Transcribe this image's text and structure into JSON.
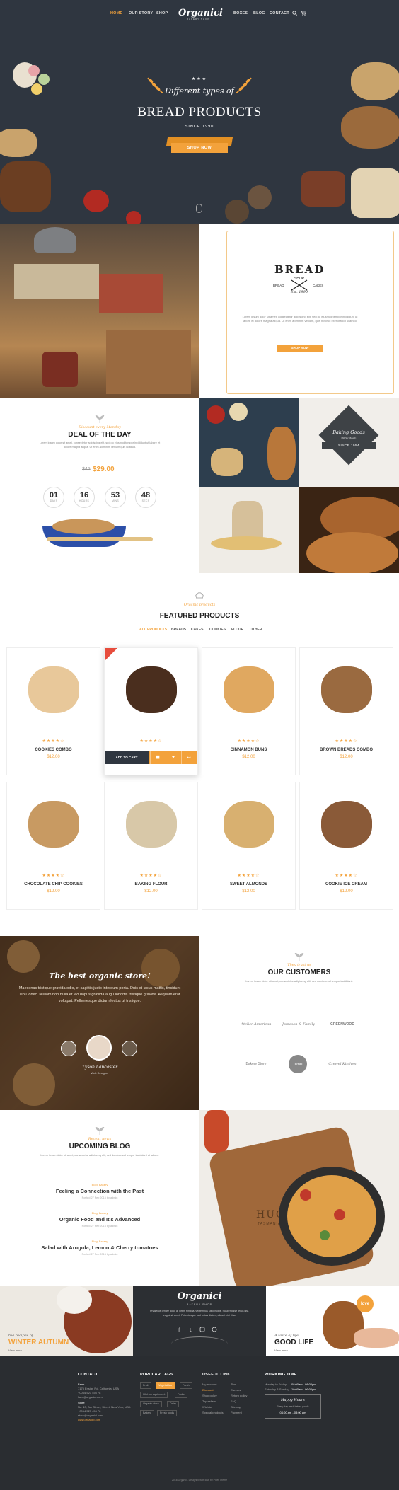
{
  "nav": {
    "left": [
      "HOME",
      "OUR STORY",
      "SHOP"
    ],
    "logo": "Organici",
    "logo_sub": "BAKERY SHOP",
    "right": [
      "BOXES",
      "BLOG",
      "CONTACT"
    ]
  },
  "hero": {
    "script": "Different types of",
    "title": "BREAD PRODUCTS",
    "since": "SINCE 1990",
    "button": "SHOP NOW"
  },
  "shop_panel": {
    "badge_title": "BREAD",
    "badge_shop": "SHOP",
    "badge_left": "BREAD",
    "badge_right": "CAKES",
    "badge_est": "Est. 1990",
    "text": "Lorem ipsum dolor sit amet, consectetur adipiscing elit, sed do eiusmod tempor incididunt ut labore et dolore magna aliqua. Ut enim ad minim veniam, quis nostrud exercitation ullamco.",
    "button": "SHOP NOW"
  },
  "deal": {
    "script": "Discount every Monday",
    "title": "DEAL OF THE DAY",
    "text": "Lorem ipsum dolor sit amet, consectetur adipiscing elit, sed do eiusmod tempor incididunt ut labore et dolore magna aliqua. Ut enim ad minim veniam quis nostrud.",
    "old_price": "$45",
    "price": "$29.00",
    "counters": [
      {
        "n": "01",
        "l": "DAYS"
      },
      {
        "n": "16",
        "l": "HOURS"
      },
      {
        "n": "53",
        "l": "MINS"
      },
      {
        "n": "48",
        "l": "SECS"
      }
    ]
  },
  "baking_badge": {
    "title": "Baking Goods",
    "sub": "HAND MADE",
    "since": "SINCE 1954"
  },
  "featured": {
    "script": "Organic products",
    "title": "FEATURED PRODUCTS",
    "filters": [
      "ALL PRODUCTS",
      "BREADS",
      "CAKES",
      "COOKIES",
      "FLOUR",
      "OTHER"
    ],
    "add_to_cart": "ADD TO CART",
    "products": [
      {
        "name": "COOKIES COMBO",
        "price": "$12.00",
        "stars": "★★★★☆",
        "color": "#e8c89a"
      },
      {
        "name": "",
        "price": "",
        "stars": "★★★★☆",
        "color": "#4a2e1e"
      },
      {
        "name": "CINNAMON BUNS",
        "price": "$12.00",
        "stars": "★★★★☆",
        "color": "#e0a860"
      },
      {
        "name": "BROWN BREADS COMBO",
        "price": "$12.00",
        "stars": "★★★★☆",
        "color": "#9a6a40"
      },
      {
        "name": "CHOCOLATE CHIP COOKIES",
        "price": "$12.00",
        "stars": "★★★★☆",
        "color": "#c89a62"
      },
      {
        "name": "BAKING FLOUR",
        "price": "$12.00",
        "stars": "★★★★☆",
        "color": "#d8c8a8"
      },
      {
        "name": "SWEET ALMONDS",
        "price": "$12.00",
        "stars": "★★★★☆",
        "color": "#d8b070"
      },
      {
        "name": "COOKIE ICE CREAM",
        "price": "$12.00",
        "stars": "★★★★☆",
        "color": "#8a5a38"
      }
    ]
  },
  "testimonial": {
    "title": "The best organic store!",
    "text": "Maecenas tristique gravida odio, et sagittis justo interdum porta. Duis et lacus mattis, tincidunt leo Donec. Nullam non nulla et leo dapus gravida augu lobortis tristique gravida. Aliquam erat volutpat. Pellentesque dictum lectus ut tristique.",
    "name": "Tyson Lancaster",
    "role": "Web Designer"
  },
  "customers": {
    "script": "They trust us",
    "title": "OUR CUSTOMERS",
    "text": "Lorem ipsum dolor sit amet, consectetur adipiscing elit, sed do eiusmod tempor incididunt.",
    "logos": [
      "Atelier American",
      "Jameson & Family",
      "GREENWOOD",
      "Bakery Store",
      "Bread",
      "Crewel Kitchen"
    ]
  },
  "blog": {
    "script": "Recent news",
    "title": "UPCOMING BLOG",
    "text": "Lorem ipsum dolor sit amet, consectetur adipiscing elit, sed do eiusmod tempor incididunt ut labore.",
    "posts": [
      {
        "cat": "Blog, Bakery",
        "title": "Feeling a Connection with the Past",
        "meta": "Posted 27 Feb 2016 by admin"
      },
      {
        "cat": "Blog, Bakery",
        "title": "Organic Food and It's Advanced",
        "meta": "Posted 27 Feb 2016 by admin"
      },
      {
        "cat": "Blog, Bakery",
        "title": "Salad with Arugula, Lemon & Cherry tomatoes",
        "meta": "Posted 27 Feb 2016 by admin"
      }
    ],
    "pizza_brand": "HUON",
    "pizza_sub": "TASMANIA"
  },
  "strip": {
    "autumn_script": "the recipes of",
    "autumn_title": "WINTER AUTUMN",
    "autumn_link": "View more",
    "chalk_logo": "Organici",
    "chalk_sub": "BAKERY SHOP",
    "chalk_text": "Phasellus ornare dolor at lorem fringilla, vel tempus justo mollis. Suspendisse tellus nisl, feugiat sit amet. Pellentesque sed lectus dictum, aliquet nisi vitae.",
    "life_script": "A taste of life",
    "life_title": "GOOD LIFE",
    "life_link": "View more",
    "love_badge": "love"
  },
  "footer": {
    "contact_h": "CONTACT",
    "contact": [
      "Farm",
      "7175 Ensign Rd, California, USA",
      "+0064 523 456 78",
      "farm@organici.com",
      "Store",
      "No. 13, Bur Street, Street, New York, USA",
      "+0064 523 456 78",
      "store@organici.com",
      "www.organici.com"
    ],
    "tags_h": "POPULAR TAGS",
    "tags": [
      "Fruit",
      "Vegetables",
      "Fresh",
      "Kitchen equipment",
      "Fruits",
      "Organic store",
      "Dairy",
      "Bakery",
      "Fresh foods"
    ],
    "links_h": "USEFUL LINK",
    "links_left": [
      "My account",
      "Discount",
      "Shop policy",
      "Top sellers",
      "Wishlist",
      "Special products"
    ],
    "links_right": [
      "Tips",
      "Careers",
      "Return policy",
      "FAQ",
      "Sitemap",
      "Payment"
    ],
    "hours_h": "WORKING TIME",
    "hours": [
      {
        "day": "Monday to Friday",
        "time": "08:00am - 08:00pm"
      },
      {
        "day": "Saturday & Sunday",
        "time": "10:00am - 06:00pm"
      }
    ],
    "badge_script": "Happy Hours",
    "badge_text": "Every day fresh baked goods",
    "badge_time": "04:00 am - 08:00 am",
    "copyright": "2016 Organici. Designed with love by Pixel Theme"
  },
  "colors": {
    "accent": "#f3a23b",
    "dark": "#2f3640",
    "footer": "#2a2d31"
  }
}
